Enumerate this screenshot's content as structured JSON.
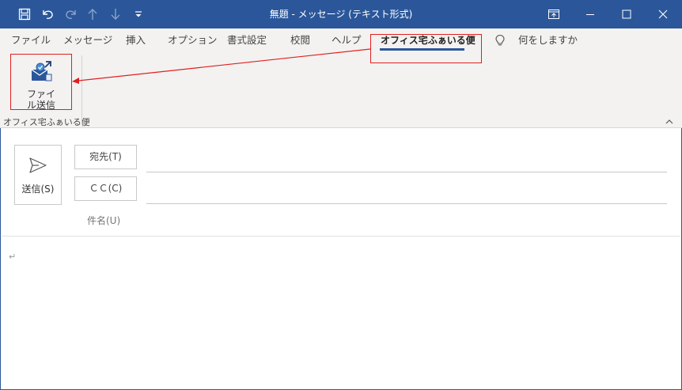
{
  "titlebar": {
    "title": "無題  -  メッセージ (テキスト形式)",
    "icons": [
      "save-icon",
      "undo-icon",
      "redo-icon",
      "up-arrow-icon",
      "down-arrow-icon",
      "customize-icon",
      "ribbon-display-icon",
      "minimize-icon",
      "maximize-icon",
      "close-icon"
    ]
  },
  "tabs": {
    "items": [
      "ファイル",
      "メッセージ",
      "挿入",
      "オプション",
      "書式設定",
      "校閲",
      "ヘルプ",
      "オフィス宅ふぁいる便"
    ],
    "active": "オフィス宅ふぁいる便",
    "tell_me": "何をしますか"
  },
  "ribbon": {
    "send_file_line1": "ファイ",
    "send_file_line2": "ル送信",
    "group_label": "オフィス宅ふぁいる便"
  },
  "compose": {
    "send_label": "送信(S)",
    "to_label": "宛先(T)",
    "cc_label": "ＣＣ(C)",
    "subject_label": "件名(U)",
    "body_mark": "↵"
  },
  "colors": {
    "accent": "#2b579a",
    "highlight": "#e02020"
  }
}
